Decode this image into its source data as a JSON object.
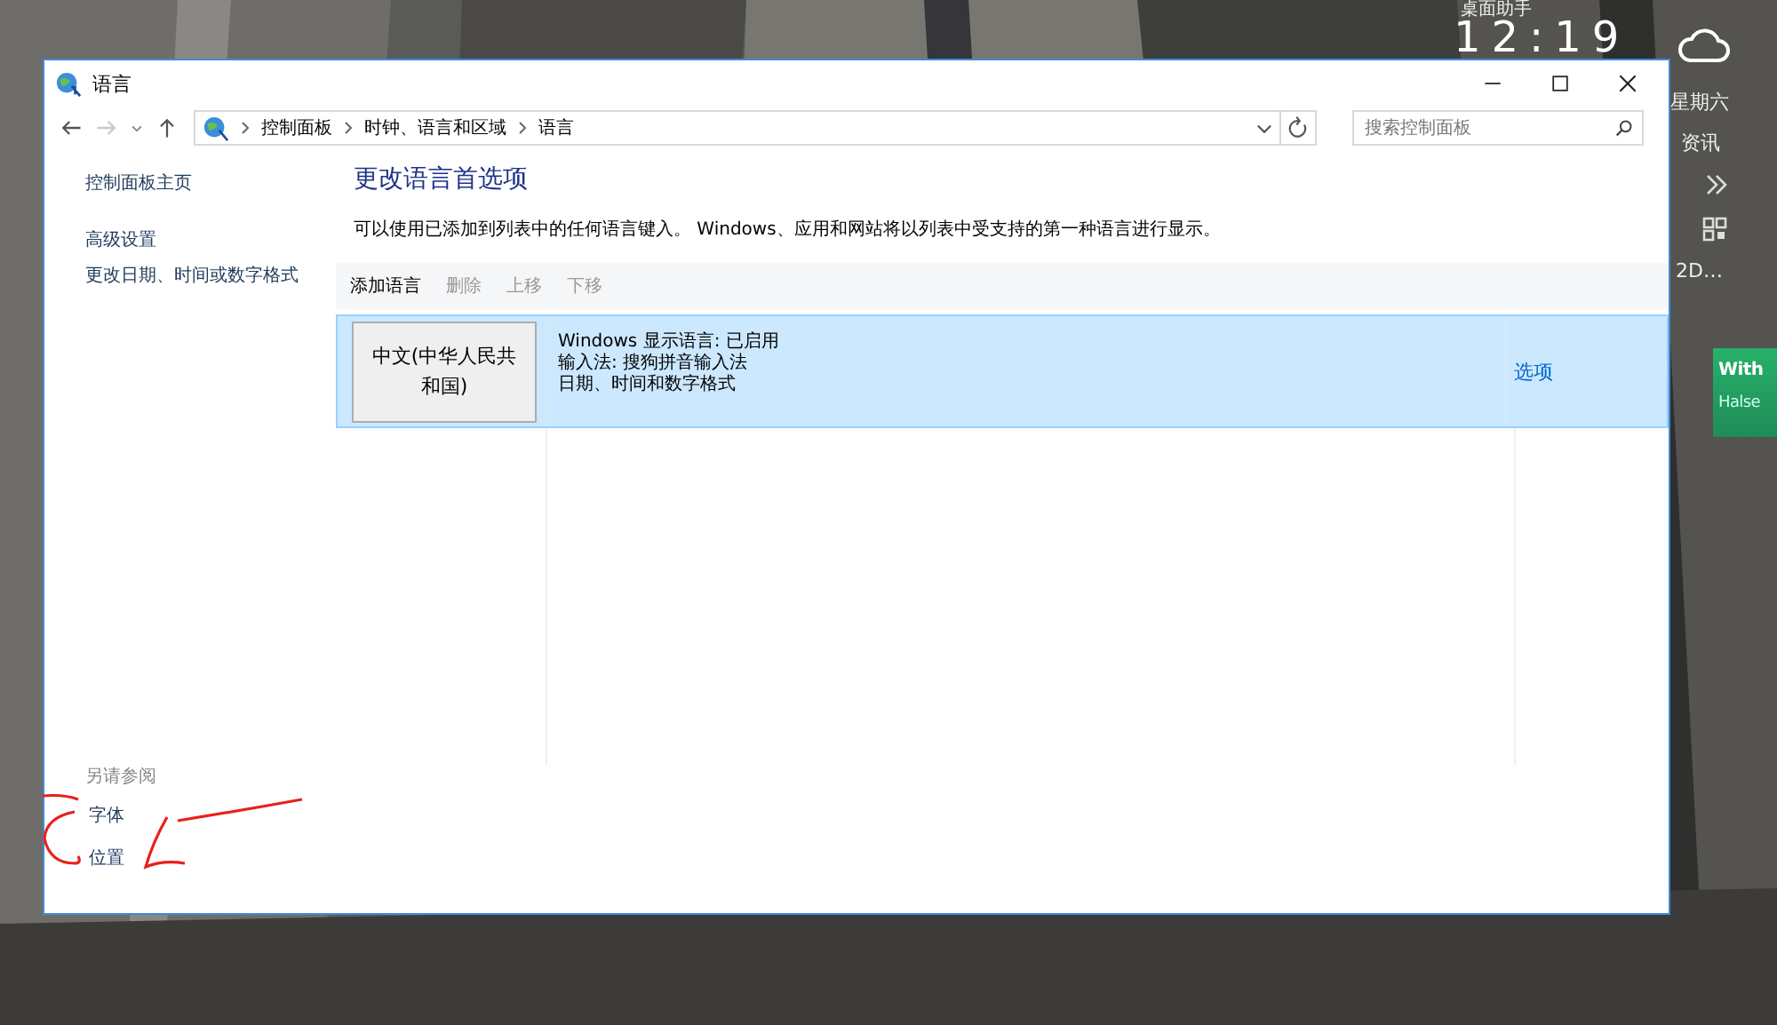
{
  "desktop_widget": {
    "title": "桌面助手",
    "clock": "12:19",
    "weekday": "星期六",
    "news": "资讯",
    "item": "2D…"
  },
  "notification": {
    "title": "With",
    "text": "Halse"
  },
  "window": {
    "title": "语言"
  },
  "address_bar": {
    "crumbs": [
      "控制面板",
      "时钟、语言和区域",
      "语言"
    ]
  },
  "search": {
    "placeholder": "搜索控制面板"
  },
  "sidebar": {
    "items": [
      "控制面板主页",
      "高级设置",
      "更改日期、时间或数字格式"
    ],
    "see_also": {
      "heading": "另请参阅",
      "items": [
        "字体",
        "位置"
      ]
    }
  },
  "main": {
    "heading": "更改语言首选项",
    "description": "可以使用已添加到列表中的任何语言键入。 Windows、应用和网站将以列表中受支持的第一种语言进行显示。",
    "toolbar": [
      {
        "label": "添加语言",
        "disabled": false
      },
      {
        "label": "删除",
        "disabled": true
      },
      {
        "label": "上移",
        "disabled": true
      },
      {
        "label": "下移",
        "disabled": true
      }
    ],
    "languages": [
      {
        "name": "中文(中华人民共和国)",
        "details": [
          "Windows 显示语言: 已启用",
          "输入法: 搜狗拼音输入法",
          "日期、时间和数字格式"
        ],
        "options": "选项",
        "selected": true
      }
    ]
  }
}
